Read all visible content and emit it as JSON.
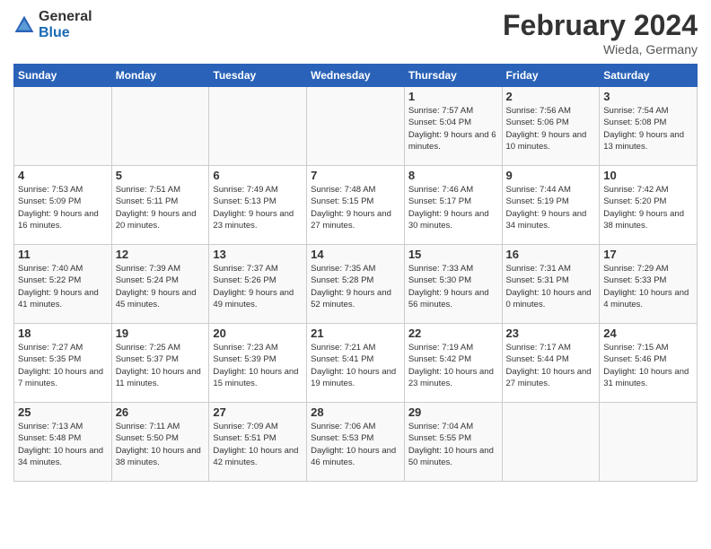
{
  "header": {
    "logo_general": "General",
    "logo_blue": "Blue",
    "month_year": "February 2024",
    "location": "Wieda, Germany"
  },
  "columns": [
    "Sunday",
    "Monday",
    "Tuesday",
    "Wednesday",
    "Thursday",
    "Friday",
    "Saturday"
  ],
  "weeks": [
    {
      "days": [
        {
          "num": "",
          "info": ""
        },
        {
          "num": "",
          "info": ""
        },
        {
          "num": "",
          "info": ""
        },
        {
          "num": "",
          "info": ""
        },
        {
          "num": "1",
          "info": "Sunrise: 7:57 AM\nSunset: 5:04 PM\nDaylight: 9 hours and 6 minutes."
        },
        {
          "num": "2",
          "info": "Sunrise: 7:56 AM\nSunset: 5:06 PM\nDaylight: 9 hours and 10 minutes."
        },
        {
          "num": "3",
          "info": "Sunrise: 7:54 AM\nSunset: 5:08 PM\nDaylight: 9 hours and 13 minutes."
        }
      ]
    },
    {
      "days": [
        {
          "num": "4",
          "info": "Sunrise: 7:53 AM\nSunset: 5:09 PM\nDaylight: 9 hours and 16 minutes."
        },
        {
          "num": "5",
          "info": "Sunrise: 7:51 AM\nSunset: 5:11 PM\nDaylight: 9 hours and 20 minutes."
        },
        {
          "num": "6",
          "info": "Sunrise: 7:49 AM\nSunset: 5:13 PM\nDaylight: 9 hours and 23 minutes."
        },
        {
          "num": "7",
          "info": "Sunrise: 7:48 AM\nSunset: 5:15 PM\nDaylight: 9 hours and 27 minutes."
        },
        {
          "num": "8",
          "info": "Sunrise: 7:46 AM\nSunset: 5:17 PM\nDaylight: 9 hours and 30 minutes."
        },
        {
          "num": "9",
          "info": "Sunrise: 7:44 AM\nSunset: 5:19 PM\nDaylight: 9 hours and 34 minutes."
        },
        {
          "num": "10",
          "info": "Sunrise: 7:42 AM\nSunset: 5:20 PM\nDaylight: 9 hours and 38 minutes."
        }
      ]
    },
    {
      "days": [
        {
          "num": "11",
          "info": "Sunrise: 7:40 AM\nSunset: 5:22 PM\nDaylight: 9 hours and 41 minutes."
        },
        {
          "num": "12",
          "info": "Sunrise: 7:39 AM\nSunset: 5:24 PM\nDaylight: 9 hours and 45 minutes."
        },
        {
          "num": "13",
          "info": "Sunrise: 7:37 AM\nSunset: 5:26 PM\nDaylight: 9 hours and 49 minutes."
        },
        {
          "num": "14",
          "info": "Sunrise: 7:35 AM\nSunset: 5:28 PM\nDaylight: 9 hours and 52 minutes."
        },
        {
          "num": "15",
          "info": "Sunrise: 7:33 AM\nSunset: 5:30 PM\nDaylight: 9 hours and 56 minutes."
        },
        {
          "num": "16",
          "info": "Sunrise: 7:31 AM\nSunset: 5:31 PM\nDaylight: 10 hours and 0 minutes."
        },
        {
          "num": "17",
          "info": "Sunrise: 7:29 AM\nSunset: 5:33 PM\nDaylight: 10 hours and 4 minutes."
        }
      ]
    },
    {
      "days": [
        {
          "num": "18",
          "info": "Sunrise: 7:27 AM\nSunset: 5:35 PM\nDaylight: 10 hours and 7 minutes."
        },
        {
          "num": "19",
          "info": "Sunrise: 7:25 AM\nSunset: 5:37 PM\nDaylight: 10 hours and 11 minutes."
        },
        {
          "num": "20",
          "info": "Sunrise: 7:23 AM\nSunset: 5:39 PM\nDaylight: 10 hours and 15 minutes."
        },
        {
          "num": "21",
          "info": "Sunrise: 7:21 AM\nSunset: 5:41 PM\nDaylight: 10 hours and 19 minutes."
        },
        {
          "num": "22",
          "info": "Sunrise: 7:19 AM\nSunset: 5:42 PM\nDaylight: 10 hours and 23 minutes."
        },
        {
          "num": "23",
          "info": "Sunrise: 7:17 AM\nSunset: 5:44 PM\nDaylight: 10 hours and 27 minutes."
        },
        {
          "num": "24",
          "info": "Sunrise: 7:15 AM\nSunset: 5:46 PM\nDaylight: 10 hours and 31 minutes."
        }
      ]
    },
    {
      "days": [
        {
          "num": "25",
          "info": "Sunrise: 7:13 AM\nSunset: 5:48 PM\nDaylight: 10 hours and 34 minutes."
        },
        {
          "num": "26",
          "info": "Sunrise: 7:11 AM\nSunset: 5:50 PM\nDaylight: 10 hours and 38 minutes."
        },
        {
          "num": "27",
          "info": "Sunrise: 7:09 AM\nSunset: 5:51 PM\nDaylight: 10 hours and 42 minutes."
        },
        {
          "num": "28",
          "info": "Sunrise: 7:06 AM\nSunset: 5:53 PM\nDaylight: 10 hours and 46 minutes."
        },
        {
          "num": "29",
          "info": "Sunrise: 7:04 AM\nSunset: 5:55 PM\nDaylight: 10 hours and 50 minutes."
        },
        {
          "num": "",
          "info": ""
        },
        {
          "num": "",
          "info": ""
        }
      ]
    }
  ]
}
